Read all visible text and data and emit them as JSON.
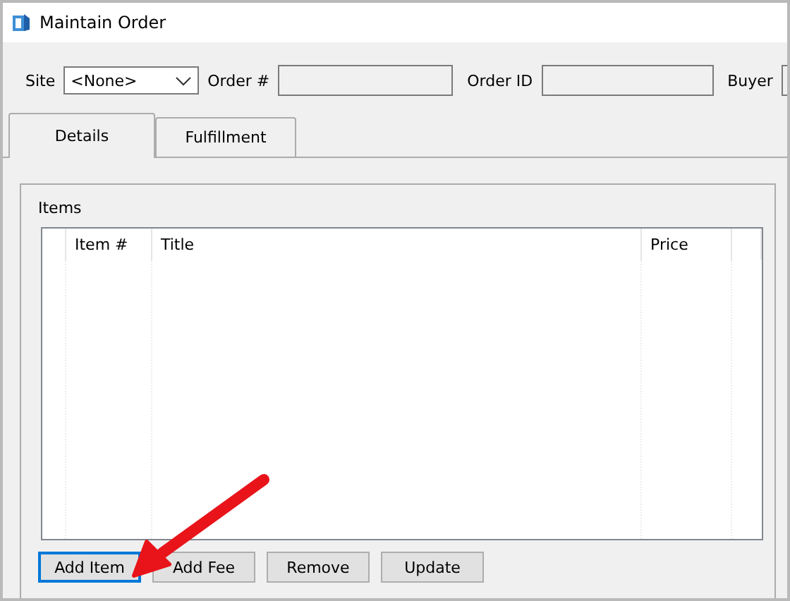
{
  "window": {
    "title": "Maintain Order"
  },
  "header_fields": [
    {
      "label": "Site",
      "kind": "dropdown",
      "value": "<None>"
    },
    {
      "label": "Order #",
      "kind": "text"
    },
    {
      "label": "Order ID",
      "kind": "text"
    },
    {
      "label": "Buyer",
      "kind": "text"
    }
  ],
  "tabs": [
    {
      "label": "Details",
      "selected": true
    },
    {
      "label": "Fulfillment",
      "selected": false
    }
  ],
  "items_group": {
    "title": "Items",
    "table": {
      "columns": [
        "Item #",
        "Title",
        "Price"
      ]
    }
  },
  "buttons": [
    {
      "label": "Add Item",
      "focused": true
    },
    {
      "label": "Add Fee",
      "focused": false
    },
    {
      "label": "Remove",
      "focused": false
    },
    {
      "label": "Update",
      "focused": false
    }
  ]
}
